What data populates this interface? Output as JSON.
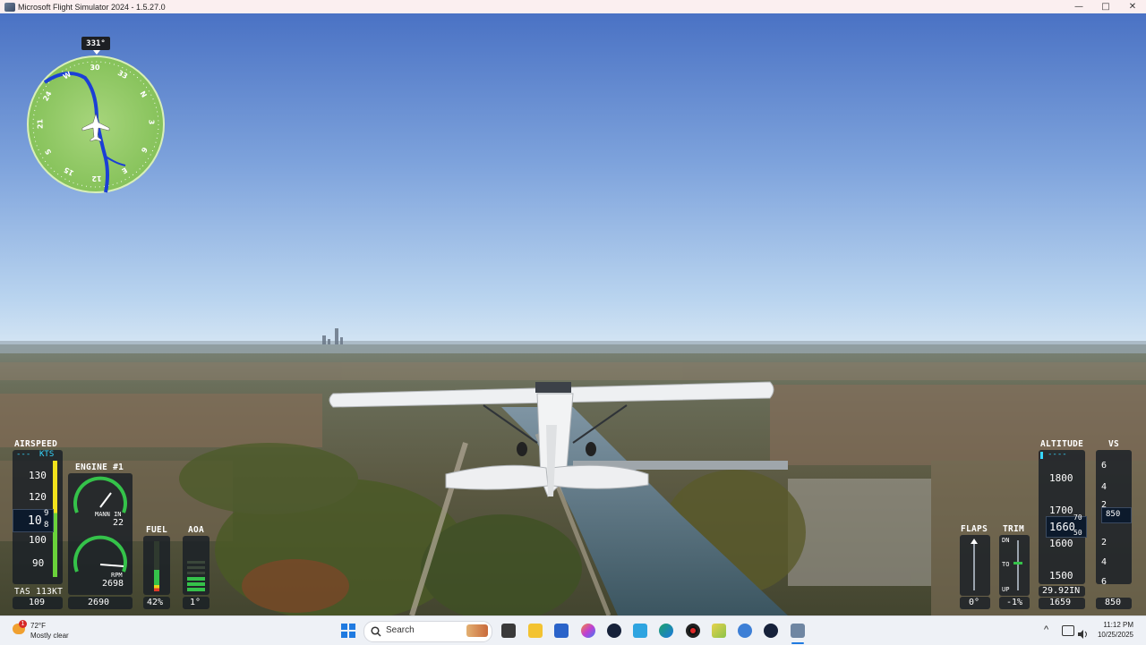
{
  "window": {
    "title": "Microsoft Flight Simulator 2024 - 1.5.27.0",
    "minimize_glyph": "—",
    "maximize_glyph": "□",
    "close_glyph": "✕"
  },
  "minimap": {
    "heading": "331°",
    "compass_labels": [
      "33",
      "N",
      "3",
      "6",
      "E",
      "12",
      "15",
      "S",
      "21",
      "24",
      "W",
      "30"
    ]
  },
  "airspeed": {
    "label": "AIRSPEED",
    "unit": "KTS",
    "unit_prefix": "---",
    "ticks": [
      "130",
      "120",
      "110",
      "100",
      "90"
    ],
    "current": "109",
    "current_display": "10",
    "roller_upper": "9",
    "roller_lower": "8",
    "tas_label": "TAS 113KT",
    "bottom_value": "109"
  },
  "engine": {
    "label": "ENGINE #1",
    "manifold_label": "MANN IN",
    "manifold_value": "22",
    "rpm_label": "RPM",
    "rpm_value": "2698",
    "bottom_value": "2690"
  },
  "fuel": {
    "label": "FUEL",
    "percent": "42%",
    "level": 0.42
  },
  "aoa": {
    "label": "AOA",
    "value": "1°"
  },
  "flaps": {
    "label": "FLAPS",
    "value": "0°"
  },
  "trim": {
    "label": "TRIM",
    "dn": "DN",
    "to": "TO",
    "up": "UP",
    "value": "-1%"
  },
  "altitude": {
    "label": "ALTITUDE",
    "top_value": "----",
    "ticks": [
      "1800",
      "1700",
      "1600",
      "1500"
    ],
    "current_display": "1660",
    "roller_upper": "70",
    "roller_lower": "50",
    "baro": "29.92IN",
    "bottom_value": "1659"
  },
  "vs": {
    "label": "VS",
    "ticks": [
      "6",
      "4",
      "2",
      "2",
      "4",
      "6"
    ],
    "current": "850",
    "bottom_value": "850"
  },
  "taskbar": {
    "weather_temp": "72°F",
    "weather_desc": "Mostly clear",
    "weather_badge": "1",
    "search_placeholder": "Search",
    "time": "11:12 PM",
    "date": "10/25/2025",
    "tray_chevron": "^"
  }
}
